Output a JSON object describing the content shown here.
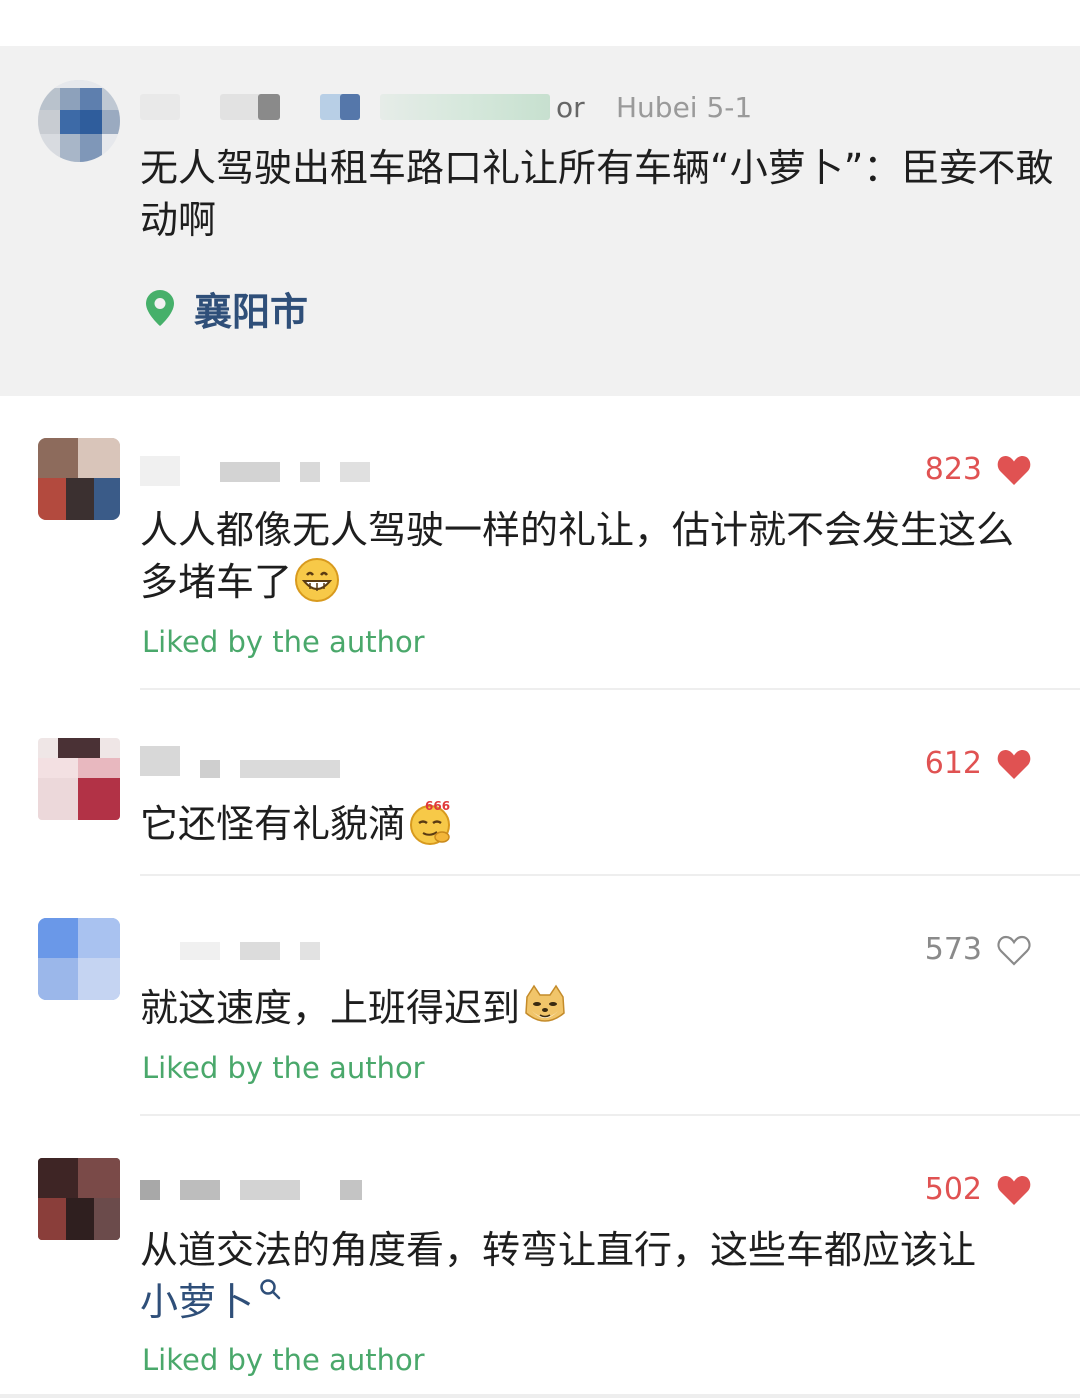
{
  "post": {
    "meta": "Hubei  5-1",
    "meta_prefix": "or",
    "title": "无人驾驶出租车路口礼让所有车辆“小萝卜”：臣妾不敢动啊",
    "location": "襄阳市"
  },
  "comments": [
    {
      "likes": "823",
      "liked": true,
      "text": "人人都像无人驾驶一样的礼让，估计就不会发生这么多堵车了",
      "emoji": "grin-emoji",
      "liked_by_author": "Liked by the author"
    },
    {
      "likes": "612",
      "liked": true,
      "text": "它还怪有礼貌滴",
      "emoji": "666-emoji",
      "liked_by_author": ""
    },
    {
      "likes": "573",
      "liked": false,
      "text": "就这速度，上班得迟到",
      "emoji": "doge-emoji",
      "liked_by_author": "Liked by the author"
    },
    {
      "likes": "502",
      "liked": true,
      "text": "从道交法的角度看，转弯让直行，这些车都应该让",
      "link": "小萝卜",
      "liked_by_author": "Liked by the author"
    }
  ],
  "colors": {
    "like_red": "#e05252",
    "liked_green": "#4aa86b",
    "link_blue": "#2f4f79",
    "card_grey": "#f1f1f1"
  }
}
